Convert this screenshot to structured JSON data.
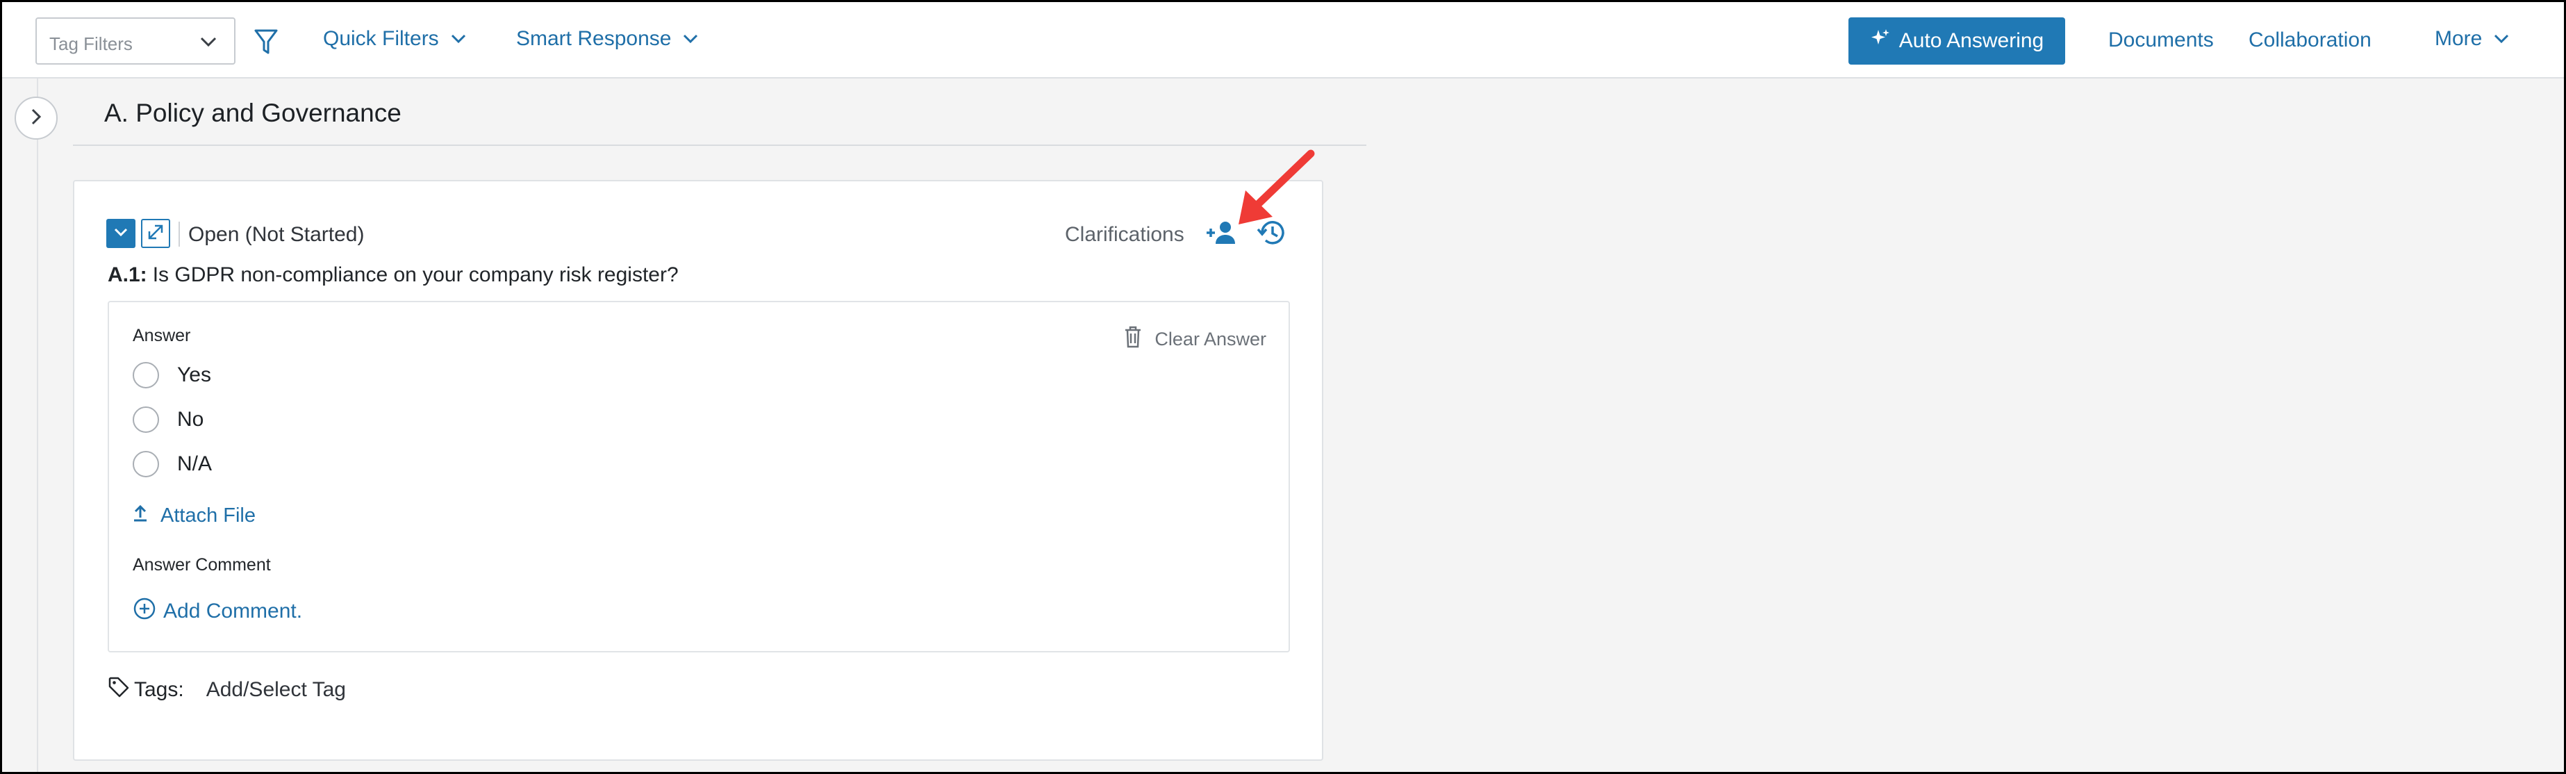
{
  "topbar": {
    "tag_filter_placeholder": "Tag Filters",
    "quick_filters_label": "Quick Filters",
    "smart_response_label": "Smart Response",
    "auto_answering_label": "Auto Answering",
    "documents_label": "Documents",
    "collaboration_label": "Collaboration",
    "more_label": "More"
  },
  "section": {
    "title": "A. Policy and Governance"
  },
  "question_card": {
    "status": "Open (Not Started)",
    "clarifications_label": "Clarifications",
    "question_id": "A.1:",
    "question_text": "Is GDPR non-compliance on your company risk register?",
    "answer_label": "Answer",
    "clear_answer_label": "Clear Answer",
    "options": [
      "Yes",
      "No",
      "N/A"
    ],
    "attach_file_label": "Attach File",
    "answer_comment_label": "Answer Comment",
    "add_comment_label": "Add Comment.",
    "tags_label": "Tags:",
    "tags_value": "Add/Select Tag"
  },
  "colors": {
    "accent": "#2079b5",
    "link": "#1f6fa8",
    "annotation_arrow": "#ef3b36"
  }
}
